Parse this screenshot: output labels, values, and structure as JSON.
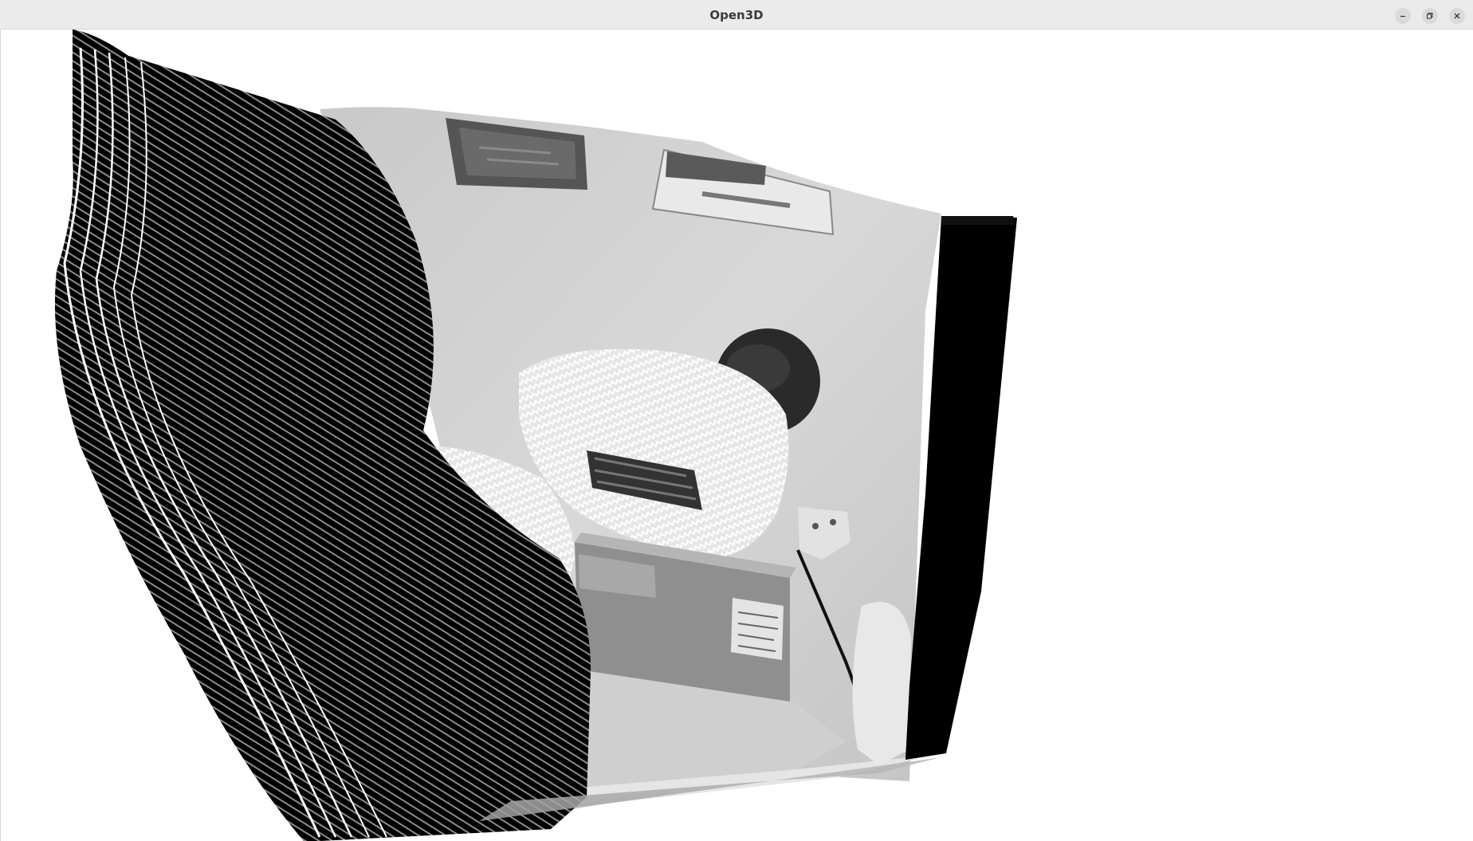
{
  "window": {
    "title": "Open3D",
    "controls": {
      "minimize": "minimize-icon",
      "maximize": "restore-icon",
      "close": "close-icon"
    }
  },
  "viewer": {
    "content": "point-cloud",
    "background_color": "#ffffff",
    "colors": {
      "far_wall": "#d9d9d9",
      "near_dark_points": "#000000",
      "mid_gray": "#9a9a9a"
    }
  }
}
